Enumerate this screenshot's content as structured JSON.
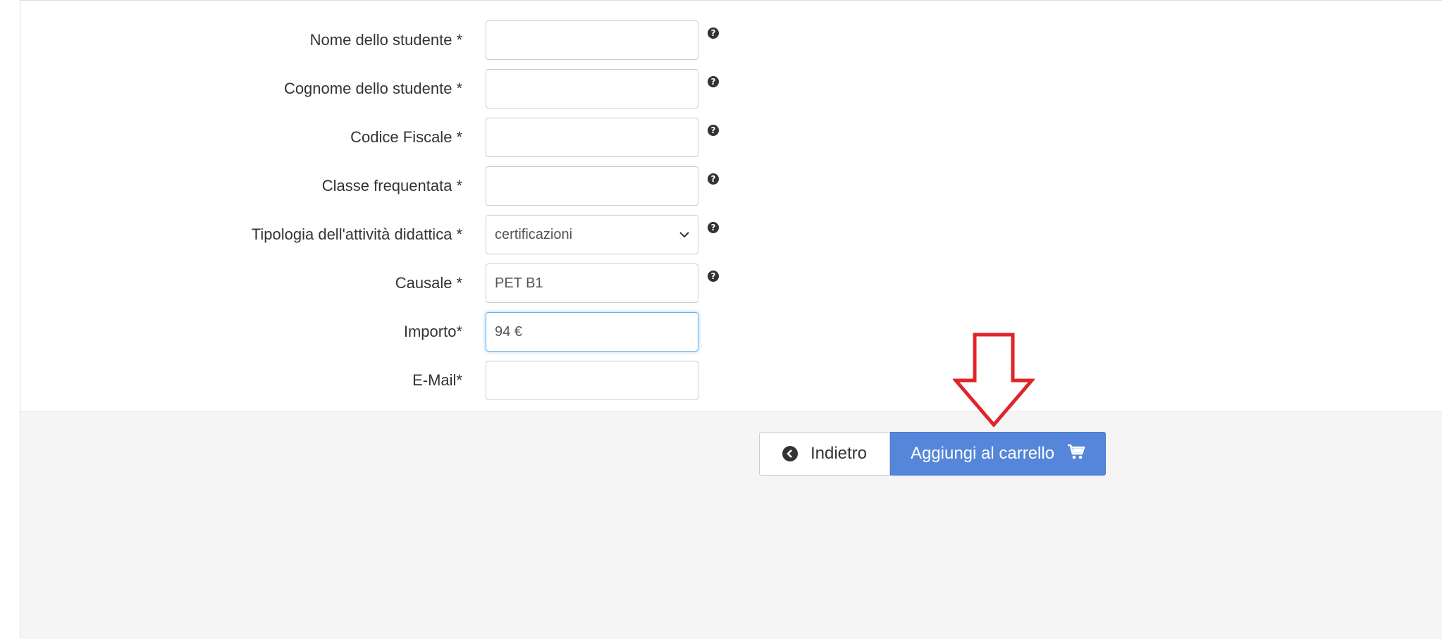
{
  "form": {
    "fields": [
      {
        "label": "Nome dello studente",
        "required_mark": "*",
        "value": "",
        "help": "?"
      },
      {
        "label": "Cognome dello studente",
        "required_mark": "*",
        "value": "",
        "help": "?"
      },
      {
        "label": "Codice Fiscale",
        "required_mark": "*",
        "value": "",
        "help": "?"
      },
      {
        "label": "Classe frequentata",
        "required_mark": "*",
        "value": "",
        "help": "?"
      },
      {
        "label": "Tipologia dell'attività didattica",
        "required_mark": "*",
        "value": "certificazioni",
        "help": "?"
      },
      {
        "label": "Causale",
        "required_mark": "*",
        "value": "PET B1",
        "help": "?"
      },
      {
        "label": "Importo*",
        "value": "94 €"
      },
      {
        "label": "E-Mail*",
        "value": ""
      }
    ]
  },
  "footer": {
    "back_label": "Indietro",
    "cart_label": "Aggiungi al carrello"
  },
  "icons": {
    "back": "chevron-left-circle-icon",
    "cart": "shopping-cart-icon",
    "help": "question-circle-icon",
    "select": "chevron-down-icon",
    "annotation": "red-down-arrow-icon"
  },
  "colors": {
    "primary_button": "#5586d9",
    "footer_bg": "#f5f5f5",
    "focus_border": "#66afe9",
    "annotation_arrow": "#e0252a"
  }
}
